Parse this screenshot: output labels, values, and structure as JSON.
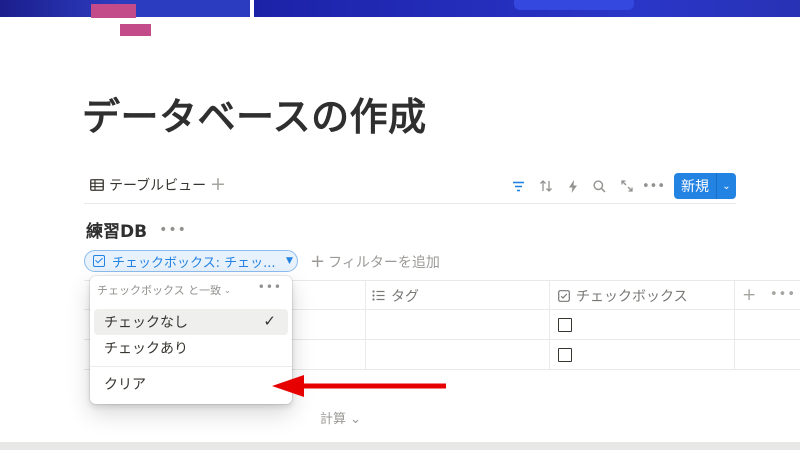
{
  "colors": {
    "accent": "#2383e2",
    "icon_pink": "#c44b8a",
    "cover_blue": "#2c3cc0",
    "annotation_arrow": "#e60000"
  },
  "page": {
    "title": "データベースの作成"
  },
  "views": {
    "tab_label": "テーブルビュー",
    "add_label": "+"
  },
  "toolbar": {
    "new_label": "新規",
    "new_menu": "⌄",
    "more": "•••"
  },
  "database": {
    "title": "練習DB",
    "more": "•••"
  },
  "filter": {
    "chip_label": "チェックボックス: チェッ...",
    "add_label": "フィルターを追加",
    "add_plus": "+"
  },
  "table": {
    "columns": [
      {
        "label": "タグ",
        "icon": "list-icon"
      },
      {
        "label": "チェックボックス",
        "icon": "checkbox-icon"
      }
    ],
    "add_column": "+",
    "more": "•••",
    "calc_label": "計算 ⌄",
    "rows": [
      {
        "checked": false
      },
      {
        "checked": false
      }
    ]
  },
  "dropdown": {
    "header_label": "チェックボックス と一致",
    "header_chevron": "⌄",
    "more": "•••",
    "options": [
      {
        "label": "チェックなし",
        "selected": true
      },
      {
        "label": "チェックあり",
        "selected": false
      }
    ],
    "selected_mark": "✓",
    "clear_label": "クリア"
  }
}
